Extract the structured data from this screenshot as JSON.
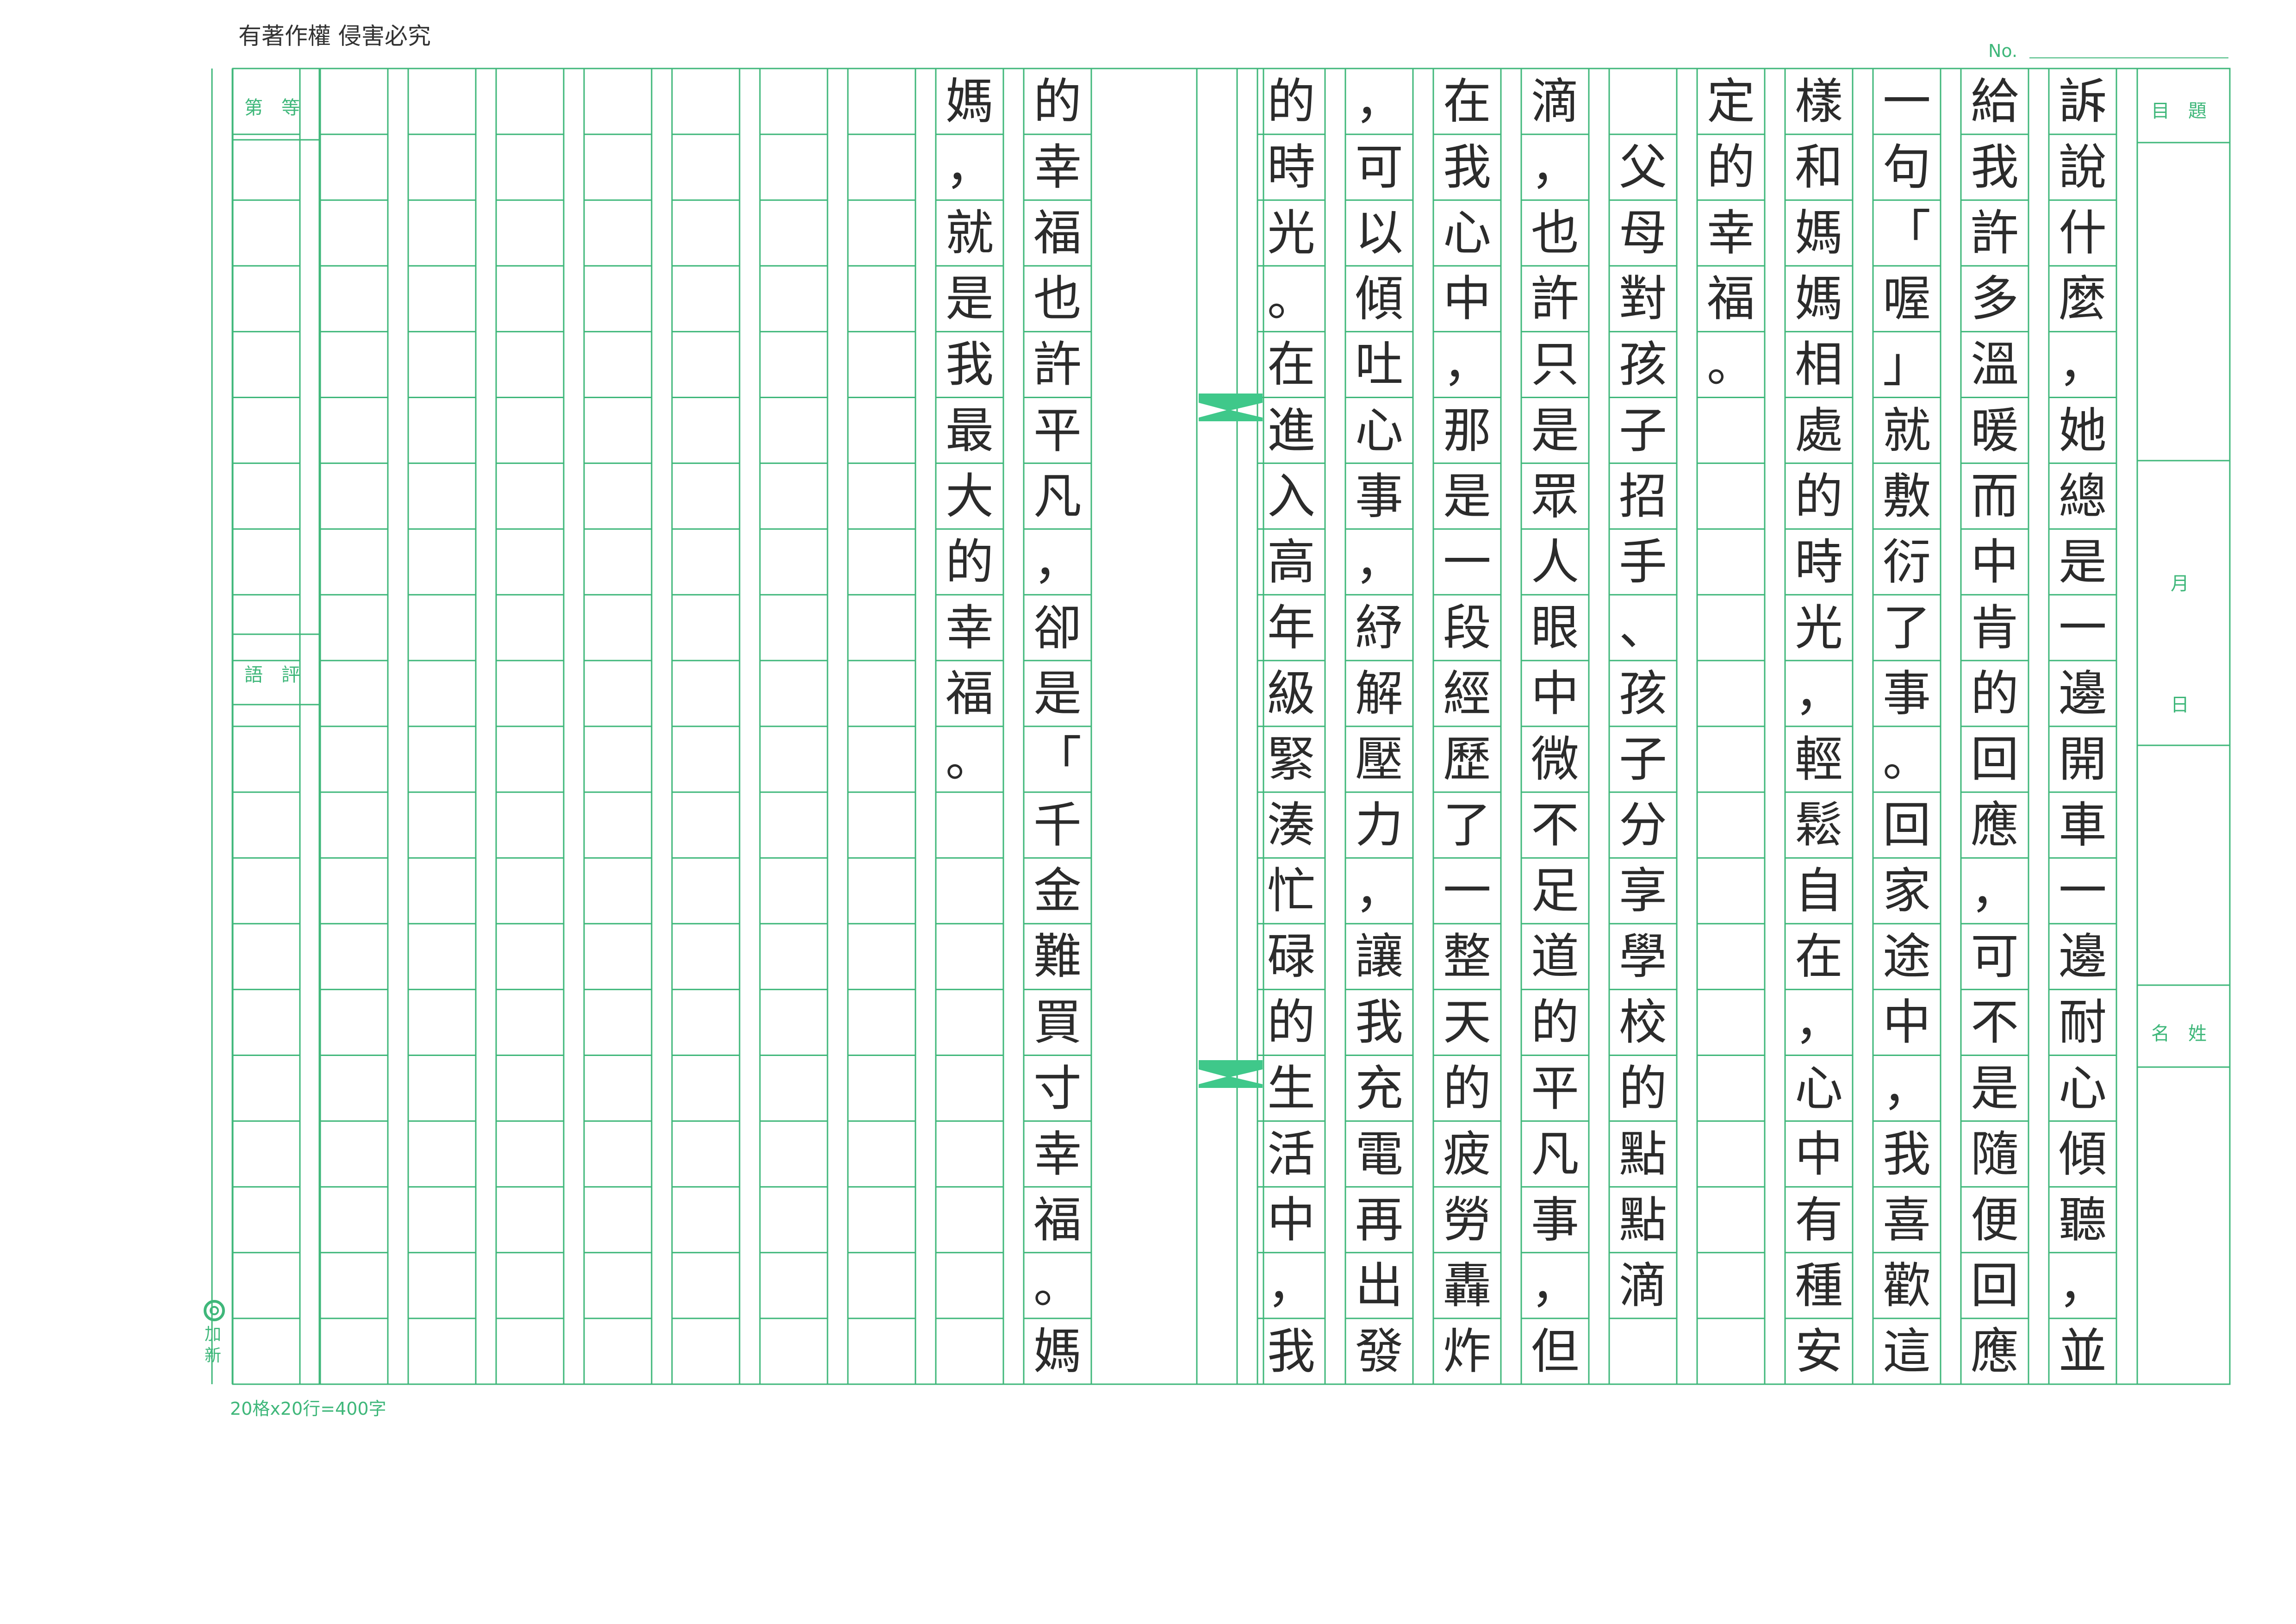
{
  "header": {
    "copyright": "有著作權 侵害必究",
    "serial_label": "No."
  },
  "left_boxes": {
    "grade": "第　等",
    "comment": "語　評"
  },
  "right_boxes": {
    "topic": "目　題",
    "month": "月",
    "day": "日",
    "name": "名　姓"
  },
  "footer": {
    "grid_spec": "20格x20行=400字"
  },
  "publisher": {
    "name": "加新"
  },
  "colors": {
    "grid_line": "#3fb77a",
    "binding_tab": "#3fc88a",
    "ink": "#2b2b2b"
  },
  "essay_columns": [
    "訴說什麼，她總是一邊開車一邊耐心傾聽，並",
    "給我許多溫暖而中肯的回應，可不是隨便回應",
    "一句「喔」就敷衍了事。回家途中，我喜歡這",
    "樣和媽媽相處的時光，輕鬆自在，心中有種安",
    "定的幸福。",
    "　父母對孩子招手、孩子分享學校的點點滴",
    "滴，也許只是眾人眼中微不足道的平凡事，但",
    "在我心中，那是一段經歷了一整天的疲勞轟炸",
    "，可以傾吐心事，紓解壓力，讓我充電再出發",
    "的時光。在進入高年級緊湊忙碌的生活中，我",
    "的幸福也許平凡，卻是「千金難買寸幸福。媽",
    "媽，就是我最大的幸福。",
    "",
    "",
    "",
    "",
    "",
    "",
    "",
    ""
  ]
}
